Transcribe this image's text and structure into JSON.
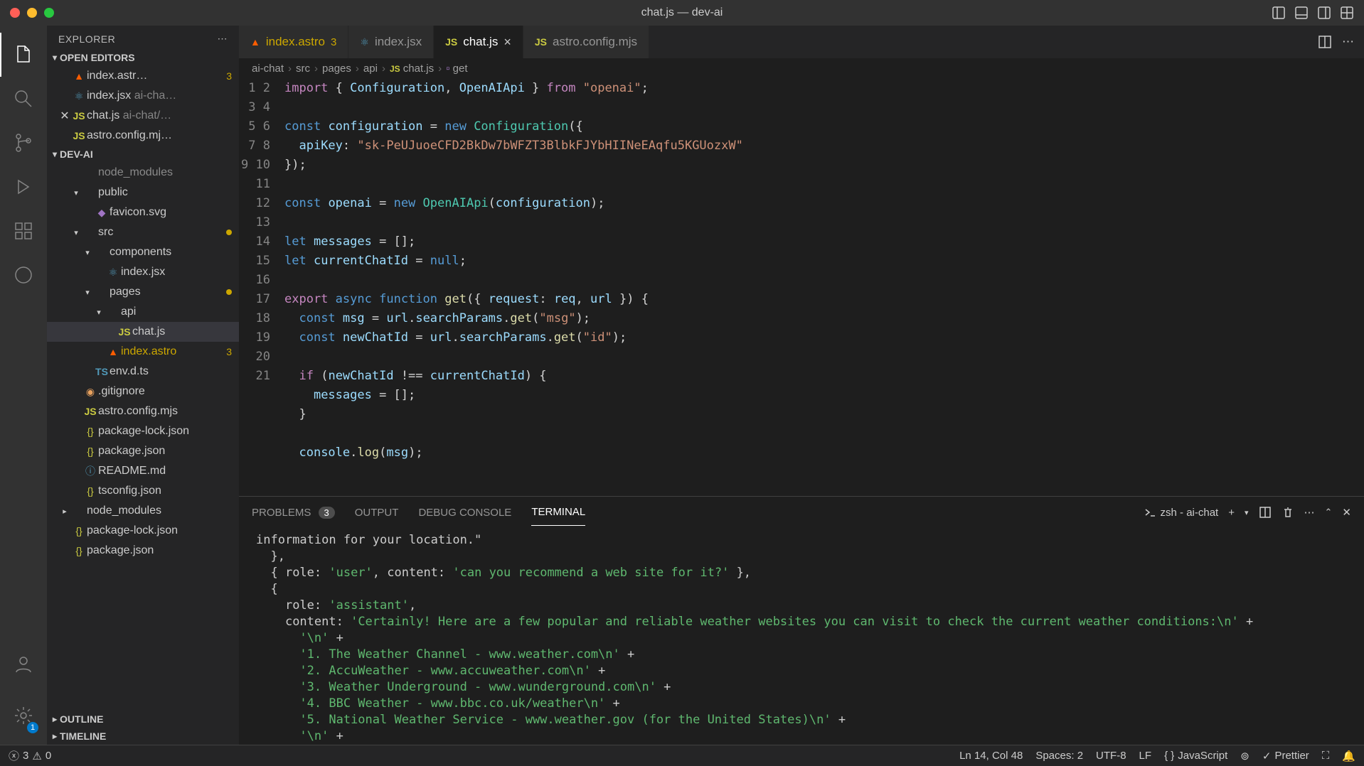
{
  "window": {
    "title": "chat.js — dev-ai"
  },
  "sidebar": {
    "title": "EXPLORER",
    "sections": {
      "openEditors": {
        "label": "OPEN EDITORS",
        "items": [
          {
            "name": "index.astr…",
            "badge": "3",
            "icon": "astro"
          },
          {
            "name": "index.jsx",
            "suffix": "ai-cha…",
            "icon": "react"
          },
          {
            "name": "chat.js",
            "suffix": "ai-chat/…",
            "icon": "js",
            "closable": true
          },
          {
            "name": "astro.config.mj…",
            "icon": "js"
          }
        ]
      },
      "project": {
        "label": "DEV-AI",
        "tree": [
          {
            "depth": 1,
            "chev": "",
            "icon": "folder",
            "name": "node_modules",
            "dim": true
          },
          {
            "depth": 1,
            "chev": "▾",
            "icon": "folder",
            "name": "public"
          },
          {
            "depth": 2,
            "chev": "",
            "icon": "svg",
            "name": "favicon.svg"
          },
          {
            "depth": 1,
            "chev": "▾",
            "icon": "folder",
            "name": "src",
            "warn": true
          },
          {
            "depth": 2,
            "chev": "▾",
            "icon": "folder",
            "name": "components"
          },
          {
            "depth": 3,
            "chev": "",
            "icon": "react",
            "name": "index.jsx"
          },
          {
            "depth": 2,
            "chev": "▾",
            "icon": "folder",
            "name": "pages",
            "warn": true
          },
          {
            "depth": 3,
            "chev": "▾",
            "icon": "folder",
            "name": "api"
          },
          {
            "depth": 4,
            "chev": "",
            "icon": "js",
            "name": "chat.js",
            "active": true
          },
          {
            "depth": 3,
            "chev": "",
            "icon": "astro",
            "name": "index.astro",
            "badge": "3"
          },
          {
            "depth": 2,
            "chev": "",
            "icon": "ts",
            "name": "env.d.ts"
          },
          {
            "depth": 1,
            "chev": "",
            "icon": "git",
            "name": ".gitignore"
          },
          {
            "depth": 1,
            "chev": "",
            "icon": "js",
            "name": "astro.config.mjs"
          },
          {
            "depth": 1,
            "chev": "",
            "icon": "json",
            "name": "package-lock.json"
          },
          {
            "depth": 1,
            "chev": "",
            "icon": "json",
            "name": "package.json"
          },
          {
            "depth": 1,
            "chev": "",
            "icon": "readme",
            "name": "README.md"
          },
          {
            "depth": 1,
            "chev": "",
            "icon": "json",
            "name": "tsconfig.json"
          },
          {
            "depth": 0,
            "chev": "▸",
            "icon": "folder",
            "name": "node_modules"
          },
          {
            "depth": 0,
            "chev": "",
            "icon": "json",
            "name": "package-lock.json"
          },
          {
            "depth": 0,
            "chev": "",
            "icon": "json",
            "name": "package.json"
          }
        ]
      },
      "outline": {
        "label": "OUTLINE"
      },
      "timeline": {
        "label": "TIMELINE"
      }
    }
  },
  "tabs": [
    {
      "icon": "astro",
      "label": "index.astro",
      "warn": "3"
    },
    {
      "icon": "react",
      "label": "index.jsx"
    },
    {
      "icon": "js",
      "label": "chat.js",
      "active": true,
      "close": true
    },
    {
      "icon": "js",
      "label": "astro.config.mjs"
    }
  ],
  "breadcrumbs": [
    "ai-chat",
    "src",
    "pages",
    "api",
    "chat.js",
    "get"
  ],
  "code": {
    "lines": [
      {
        "n": 1,
        "html": "<span class='kw'>import</span> { <span class='var'>Configuration</span>, <span class='var'>OpenAIApi</span> } <span class='kw'>from</span> <span class='str'>\"openai\"</span>;"
      },
      {
        "n": 2,
        "html": ""
      },
      {
        "n": 3,
        "html": "<span class='kw2'>const</span> <span class='var'>configuration</span> = <span class='kw2'>new</span> <span class='cls'>Configuration</span>({"
      },
      {
        "n": 4,
        "html": "  <span class='var'>apiKey</span>: <span class='str'>\"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\"</span>"
      },
      {
        "n": 5,
        "html": "});"
      },
      {
        "n": 6,
        "html": ""
      },
      {
        "n": 7,
        "html": "<span class='kw2'>const</span> <span class='var'>openai</span> = <span class='kw2'>new</span> <span class='cls'>OpenAIApi</span>(<span class='var'>configuration</span>);"
      },
      {
        "n": 8,
        "html": ""
      },
      {
        "n": 9,
        "html": "<span class='kw2'>let</span> <span class='var'>messages</span> = [];"
      },
      {
        "n": 10,
        "html": "<span class='kw2'>let</span> <span class='var'>currentChatId</span> = <span class='kw2'>null</span>;"
      },
      {
        "n": 11,
        "html": ""
      },
      {
        "n": 12,
        "html": "<span class='kw'>export</span> <span class='kw2'>async</span> <span class='kw2'>function</span> <span class='fn'>get</span>({ <span class='var'>request</span>: <span class='var'>req</span>, <span class='var'>url</span> }) {"
      },
      {
        "n": 13,
        "html": "  <span class='kw2'>const</span> <span class='var'>msg</span> = <span class='var'>url</span>.<span class='var'>searchParams</span>.<span class='fn'>get</span>(<span class='str'>\"msg\"</span>);"
      },
      {
        "n": 14,
        "html": "  <span class='kw2'>const</span> <span class='var'>newChatId</span> = <span class='var'>url</span>.<span class='var'>searchParams</span>.<span class='fn'>get</span>(<span class='str'>\"id\"</span>);"
      },
      {
        "n": 15,
        "html": ""
      },
      {
        "n": 16,
        "html": "  <span class='kw'>if</span> (<span class='var'>newChatId</span> !== <span class='var'>currentChatId</span>) {"
      },
      {
        "n": 17,
        "html": "    <span class='var'>messages</span> = [];"
      },
      {
        "n": 18,
        "html": "  }"
      },
      {
        "n": 19,
        "html": ""
      },
      {
        "n": 20,
        "html": "  <span class='var'>console</span>.<span class='fn'>log</span>(<span class='var'>msg</span>);"
      },
      {
        "n": 21,
        "html": ""
      }
    ]
  },
  "panel": {
    "tabs": {
      "problems": "PROBLEMS",
      "problemsCount": "3",
      "output": "OUTPUT",
      "debug": "DEBUG CONSOLE",
      "terminal": "TERMINAL"
    },
    "terminalName": "zsh - ai-chat",
    "terminalLines": [
      {
        "plain": "information for your location.\""
      },
      {
        "plain": "  },"
      },
      {
        "mixed": "  { role: <span class='term-str'>'user'</span>, content: <span class='term-str'>'can you recommend a web site for it?'</span> },"
      },
      {
        "plain": "  {"
      },
      {
        "mixed": "    role: <span class='term-str'>'assistant'</span>,"
      },
      {
        "mixed": "    content: <span class='term-str'>'Certainly! Here are a few popular and reliable weather websites you can visit to check the current weather conditions:\\n'</span> +"
      },
      {
        "mixed": "      <span class='term-str'>'\\n'</span> +"
      },
      {
        "mixed": "      <span class='term-str'>'1. The Weather Channel - www.weather.com\\n'</span> +"
      },
      {
        "mixed": "      <span class='term-str'>'2. AccuWeather - www.accuweather.com\\n'</span> +"
      },
      {
        "mixed": "      <span class='term-str'>'3. Weather Underground - www.wunderground.com\\n'</span> +"
      },
      {
        "mixed": "      <span class='term-str'>'4. BBC Weather - www.bbc.co.uk/weather\\n'</span> +"
      },
      {
        "mixed": "      <span class='term-str'>'5. National Weather Service - www.weather.gov (for the United States)\\n'</span> +"
      },
      {
        "mixed": "      <span class='term-str'>'\\n'</span> +"
      }
    ]
  },
  "statusbar": {
    "errors": "3",
    "warnings": "0",
    "cursor": "Ln 14, Col 48",
    "spaces": "Spaces: 2",
    "encoding": "UTF-8",
    "eol": "LF",
    "lang": "JavaScript",
    "prettier": "Prettier"
  },
  "settingsBadge": "1"
}
